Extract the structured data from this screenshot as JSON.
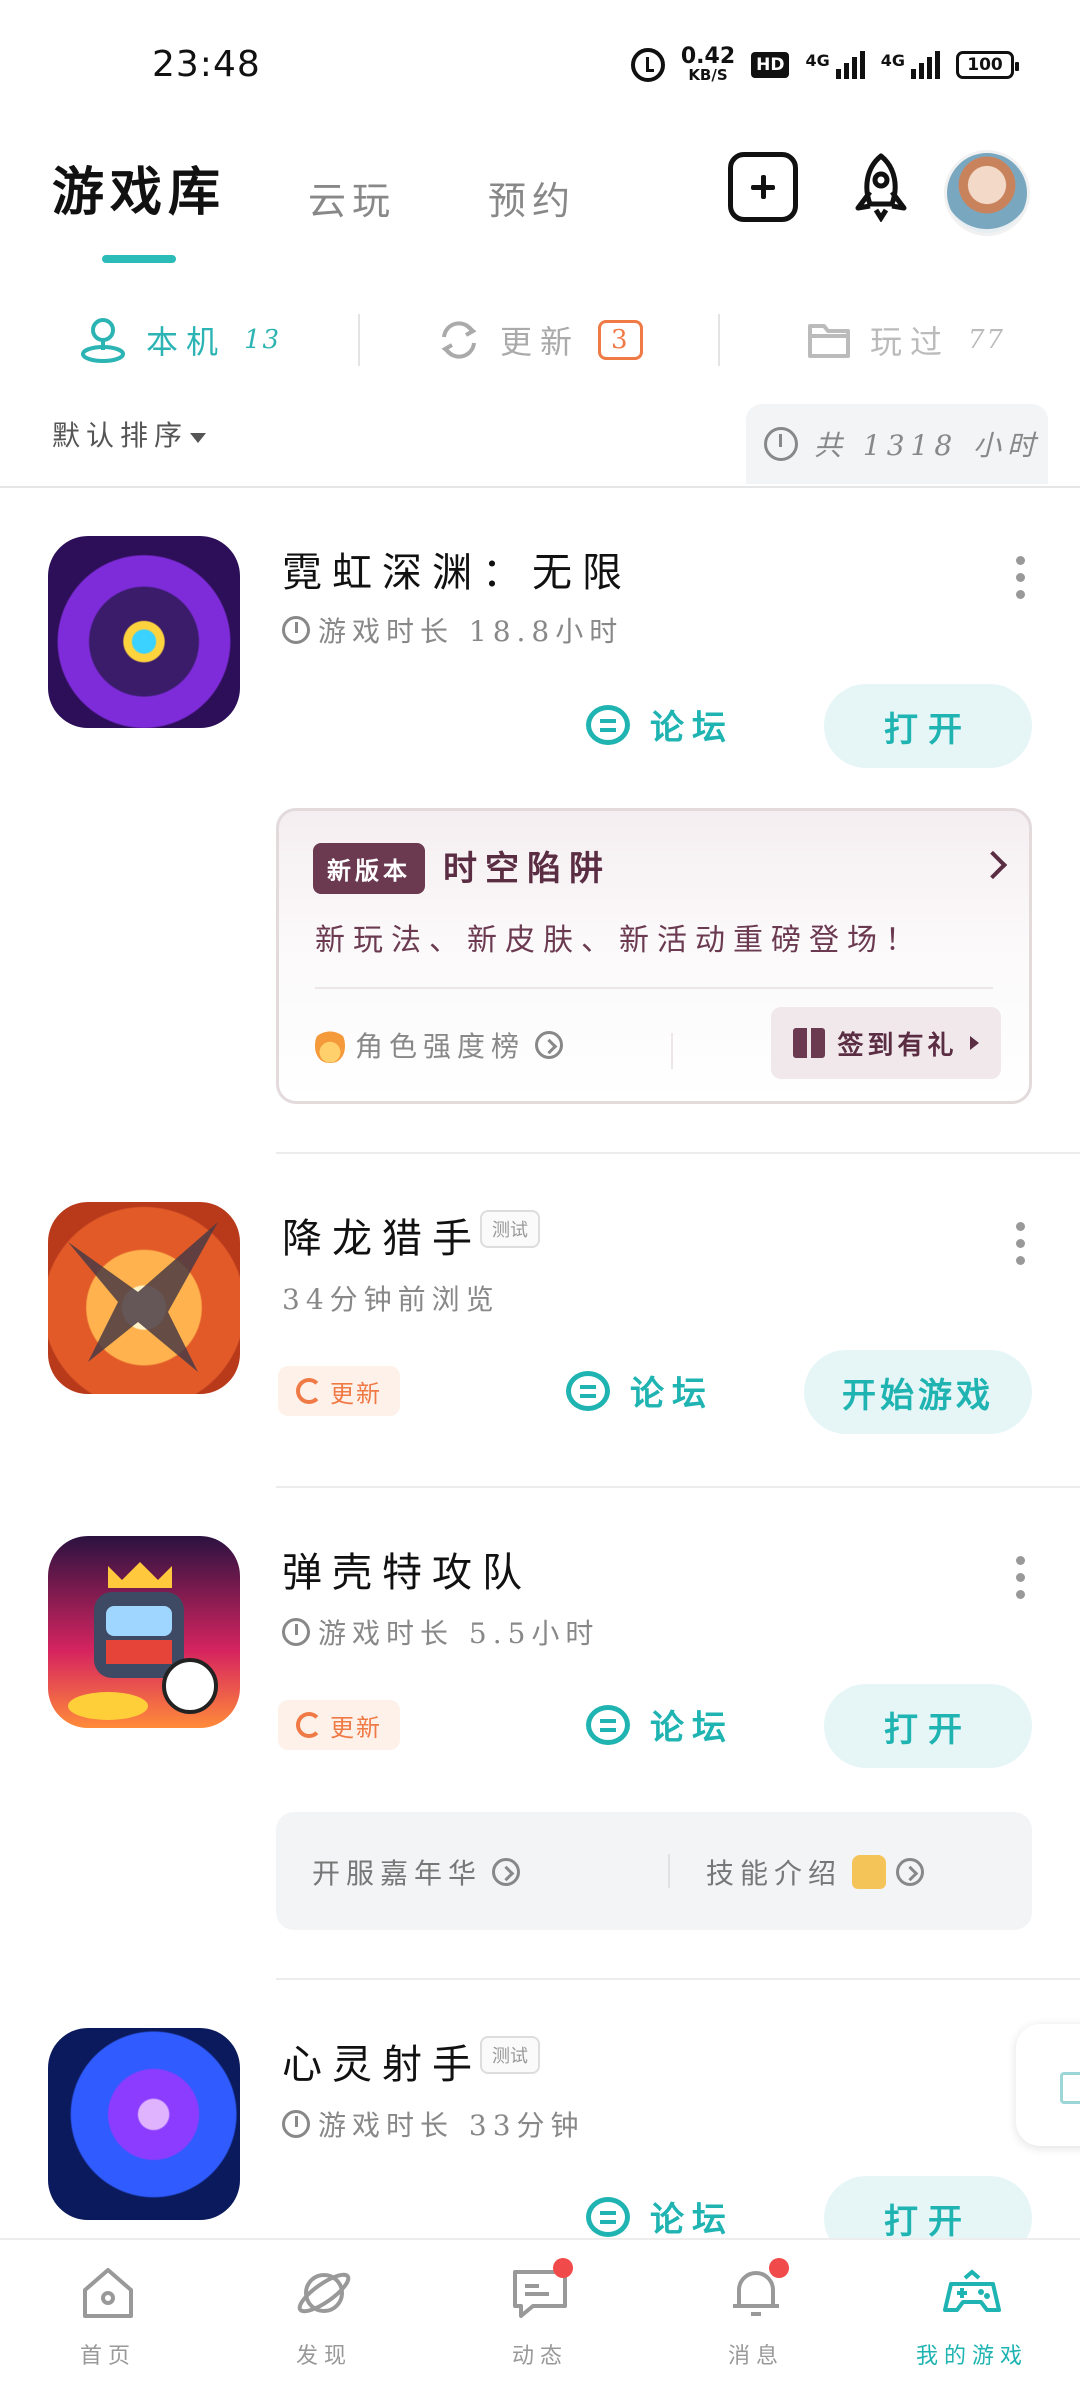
{
  "status_bar": {
    "time": "23:48",
    "net_speed": "0.42",
    "net_unit": "KB/S",
    "hd_label": "HD",
    "sig1_label": "4G",
    "sig2_label": "4G",
    "battery": "100"
  },
  "header": {
    "tabs": [
      {
        "label": "游戏库",
        "active": true
      },
      {
        "label": "云玩",
        "active": false
      },
      {
        "label": "预约",
        "active": false
      }
    ]
  },
  "filters": {
    "local": {
      "label": "本机",
      "count": "13"
    },
    "update": {
      "label": "更新",
      "count": "3"
    },
    "played": {
      "label": "玩过",
      "count": "77"
    }
  },
  "sort_label": "默认排序",
  "total_time": "共 1318 小时",
  "games": [
    {
      "title": "霓虹深渊：无限",
      "sub": "游戏时长 18.8小时",
      "forum": "论坛",
      "action": "打开"
    },
    {
      "title": "降龙猎手",
      "tag": "测试",
      "sub": "34分钟前浏览",
      "update": "更新",
      "forum": "论坛",
      "action": "开始游戏"
    },
    {
      "title": "弹壳特攻队",
      "sub": "游戏时长 5.5小时",
      "update": "更新",
      "forum": "论坛",
      "action": "打开"
    },
    {
      "title": "心灵射手",
      "tag": "测试",
      "sub": "游戏时长 33分钟",
      "forum": "论坛",
      "action": "打开"
    }
  ],
  "promo": {
    "badge": "新版本",
    "title": "时空陷阱",
    "desc": "新玩法、新皮肤、新活动重磅登场！",
    "rank": "角色强度榜",
    "gift": "签到有礼"
  },
  "links": {
    "left": "开服嘉年华",
    "right": "技能介绍"
  },
  "bottom_nav": [
    {
      "label": "首页",
      "icon": "home-icon"
    },
    {
      "label": "发现",
      "icon": "planet-icon"
    },
    {
      "label": "动态",
      "icon": "chat-icon"
    },
    {
      "label": "消息",
      "icon": "bell-icon"
    },
    {
      "label": "我的游戏",
      "icon": "gamepad-icon",
      "active": true
    }
  ],
  "colors": {
    "accent": "#1fb4b2",
    "update": "#f07a45",
    "promo": "#6b3a50"
  }
}
